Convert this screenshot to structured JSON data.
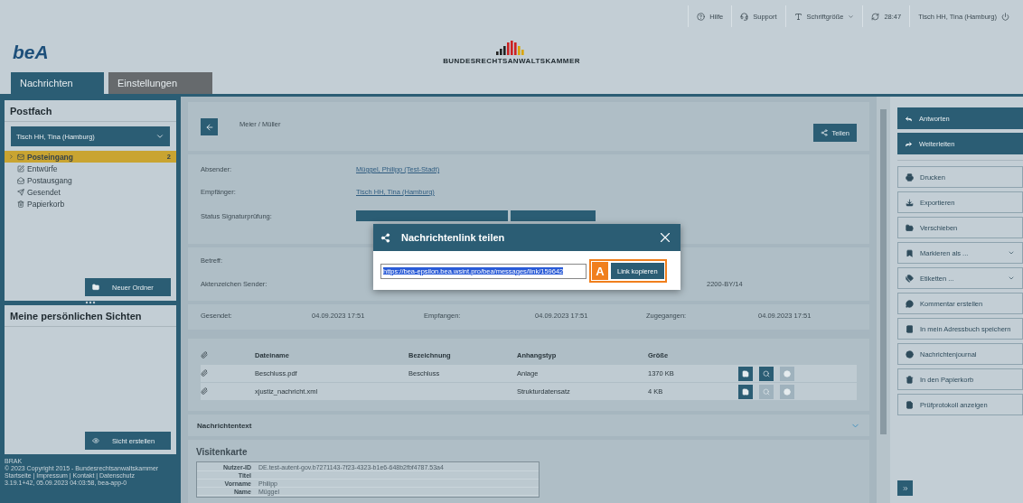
{
  "top_bar": {
    "items": [
      {
        "kind": "help",
        "label": "Hilfe"
      },
      {
        "kind": "support",
        "label": "Support"
      },
      {
        "kind": "font",
        "label": "Schriftgröße",
        "has_menu": true
      },
      {
        "kind": "session",
        "label": "28:47"
      },
      {
        "kind": "user",
        "label": "Tisch HH, Tina (Hamburg)"
      }
    ]
  },
  "logo": {
    "text": "beA"
  },
  "brand": {
    "name": "BUNDESRECHTSANWALTSKAMMER"
  },
  "tabs": [
    {
      "label": "Nachrichten",
      "selected": true
    },
    {
      "label": "Einstellungen",
      "selected": false
    }
  ],
  "sidebar": {
    "postfach": {
      "title": "Postfach",
      "account": "Tisch HH, Tina (Hamburg)",
      "folders": [
        {
          "label": "Posteingang",
          "count": "2",
          "selected": true
        },
        {
          "label": "Entwürfe",
          "selected": false
        },
        {
          "label": "Postausgang",
          "selected": false
        },
        {
          "label": "Gesendet",
          "selected": false
        },
        {
          "label": "Papierkorb",
          "selected": false
        }
      ],
      "new_folder_button": "Neuer Ordner"
    },
    "views": {
      "title": "Meine persönlichen Sichten",
      "create_button": "Sicht erstellen"
    },
    "footer": {
      "mark": "BRAK",
      "copyright": "© 2023 Copyright 2015 - Bundesrechtsanwaltskammer",
      "links": "Startseite | Impressum | Kontakt | Datenschutz",
      "version": "3.19.1+42, 05.09.2023 04:03:58, bea-app-0"
    }
  },
  "message": {
    "subject_line": "Meier / Müller",
    "share_button": "Teilen",
    "parties": [
      {
        "label": "Absender:",
        "value": "Müggel, Philipp (Test-Stadt)"
      },
      {
        "label": "Empfänger:",
        "value": "Tisch HH, Tina (Hamburg)"
      },
      {
        "label": "Status Signaturprüfung:"
      }
    ],
    "references": [
      {
        "label": "Betreff:"
      },
      {
        "label": "Aktenzeichen Sender:",
        "value": "2200-BY/14"
      }
    ],
    "dates": [
      {
        "label": "Gesendet:",
        "value": "04.09.2023 17:51"
      },
      {
        "label": "Empfangen:",
        "value": "04.09.2023 17:51"
      },
      {
        "label": "Zugegangen:",
        "value": "04.09.2023 17:51"
      }
    ],
    "attachments": {
      "columns": [
        "Dateiname",
        "Bezeichnung",
        "Anhangstyp",
        "Größe"
      ],
      "rows": [
        {
          "cells": [
            "Beschluss.pdf",
            "Beschluss",
            "Anlage",
            "1370 KB"
          ],
          "actions": [
            {
              "kind": "save",
              "disabled": false
            },
            {
              "kind": "view",
              "disabled": false
            },
            {
              "kind": "sign",
              "disabled": true
            }
          ]
        },
        {
          "cells": [
            "xjustiz_nachricht.xml",
            "",
            "Strukturdatensatz",
            "4 KB"
          ],
          "actions": [
            {
              "kind": "save",
              "disabled": false
            },
            {
              "kind": "view",
              "disabled": true
            },
            {
              "kind": "sign",
              "disabled": true
            }
          ]
        }
      ]
    },
    "text_section": {
      "title": "Nachrichtentext",
      "expanded": false
    },
    "card": {
      "title": "Visitenkarte",
      "rows": [
        {
          "label": "Nutzer-ID",
          "value": "DE.test-autent-gov.b7271143-7f23-4323-b1e6-648b2fbf4787.53a4"
        },
        {
          "label": "Titel",
          "value": ""
        },
        {
          "label": "Vorname",
          "value": "Philipp"
        },
        {
          "label": "Name",
          "value": "Müggel"
        }
      ]
    }
  },
  "actions": [
    {
      "kind": "primary",
      "label": "Antworten"
    },
    {
      "kind": "primary",
      "label": "Weiterleiten"
    },
    {
      "kind": "secondary",
      "label": "Drucken"
    },
    {
      "kind": "secondary",
      "label": "Exportieren"
    },
    {
      "kind": "secondary",
      "label": "Verschieben"
    },
    {
      "kind": "secondary",
      "label": "Markieren als ...",
      "has_menu": true
    },
    {
      "kind": "secondary",
      "label": "Etiketten ...",
      "has_menu": true
    },
    {
      "kind": "secondary",
      "label": "Kommentar erstellen"
    },
    {
      "kind": "secondary",
      "label": "In mein Adressbuch speichern"
    },
    {
      "kind": "secondary",
      "label": "Nachrichtenjournal"
    },
    {
      "kind": "secondary",
      "label": "In den Papierkorb"
    },
    {
      "kind": "secondary",
      "label": "Prüfprotokoll anzeigen"
    }
  ],
  "dialog": {
    "title": "Nachrichtenlink teilen",
    "link": "https://bea-epsilon.bea.wsint.pro/bea/messages/link/159642",
    "marker": "A",
    "copy_button": "Link kopieren"
  }
}
